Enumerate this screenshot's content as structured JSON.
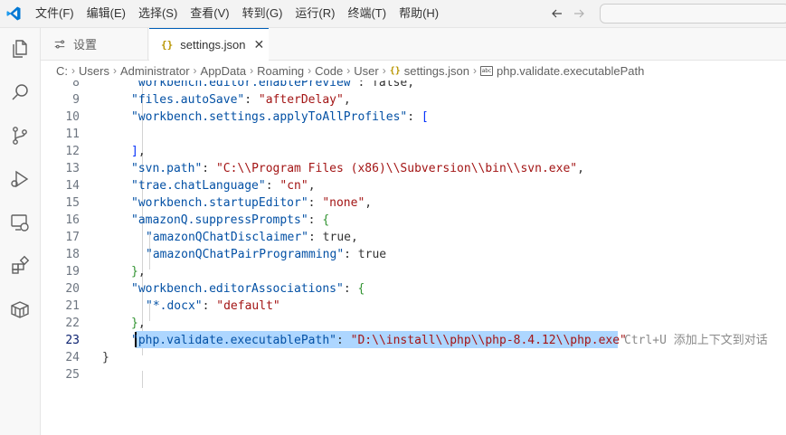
{
  "menu": {
    "items": [
      "文件(F)",
      "编辑(E)",
      "选择(S)",
      "查看(V)",
      "转到(G)",
      "运行(R)",
      "终端(T)",
      "帮助(H)"
    ]
  },
  "tabs": [
    {
      "label": "设置",
      "icon": "settings-gear-icon",
      "active": false
    },
    {
      "label": "settings.json",
      "icon": "json-braces-icon",
      "active": true
    }
  ],
  "breadcrumb": [
    "C:",
    "Users",
    "Administrator",
    "AppData",
    "Roaming",
    "Code",
    "User",
    "settings.json",
    "php.validate.executablePath"
  ],
  "editor": {
    "current_line": 23,
    "lines": [
      {
        "n": 8,
        "text": "\"workbench.editor.enablePreview\": false,"
      },
      {
        "n": 9,
        "text": "\"files.autoSave\": \"afterDelay\","
      },
      {
        "n": 10,
        "text": "\"workbench.settings.applyToAllProfiles\": ["
      },
      {
        "n": 11,
        "text": ""
      },
      {
        "n": 12,
        "text": "],"
      },
      {
        "n": 13,
        "text": "\"svn.path\": \"C:\\\\Program Files (x86)\\\\Subversion\\\\bin\\\\svn.exe\","
      },
      {
        "n": 14,
        "text": "\"trae.chatLanguage\": \"cn\","
      },
      {
        "n": 15,
        "text": "\"workbench.startupEditor\": \"none\","
      },
      {
        "n": 16,
        "text": "\"amazonQ.suppressPrompts\": {"
      },
      {
        "n": 17,
        "text": "\"amazonQChatDisclaimer\": true,"
      },
      {
        "n": 18,
        "text": "\"amazonQChatPairProgramming\": true"
      },
      {
        "n": 19,
        "text": "},"
      },
      {
        "n": 20,
        "text": "\"workbench.editorAssociations\": {"
      },
      {
        "n": 21,
        "text": "\"*.docx\": \"default\""
      },
      {
        "n": 22,
        "text": "},"
      },
      {
        "n": 23,
        "text": "\"php.validate.executablePath\": \"D:\\\\install\\\\php\\\\php-8.4.12\\\\php.exe\""
      },
      {
        "n": 24,
        "text": "}"
      },
      {
        "n": 25,
        "text": ""
      }
    ],
    "inline_hint": {
      "shortcut": "Ctrl+U",
      "text": "添加上下文到对话"
    }
  },
  "colors": {
    "accent": "#005fb8",
    "selection": "#add6ff",
    "json_key": "#0451a5",
    "json_string": "#a31515",
    "json_literal": "#0000ff"
  }
}
